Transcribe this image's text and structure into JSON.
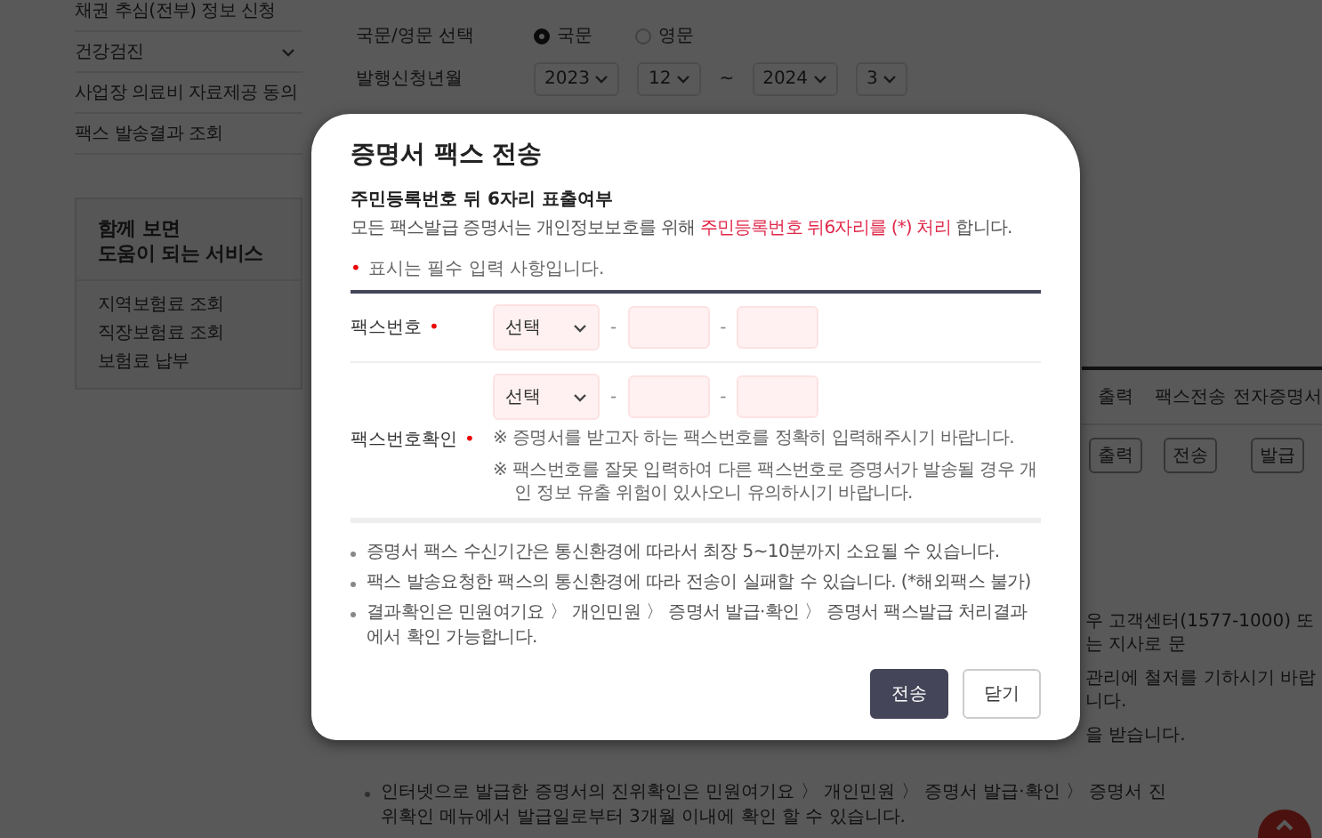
{
  "sidebar": {
    "items": [
      {
        "label": "채권 추심(전부) 정보 신청",
        "expandable": false
      },
      {
        "label": "건강검진",
        "expandable": true
      },
      {
        "label": "사업장 의료비 자료제공 동의",
        "expandable": false
      },
      {
        "label": "팩스 발송결과 조회",
        "expandable": false
      }
    ]
  },
  "related_services": {
    "title_lines": [
      "함께 보면",
      "도움이 되는 서비스"
    ],
    "items": [
      "지역보험료 조회",
      "직장보험료 조회",
      "보험료 납부"
    ]
  },
  "form": {
    "language": {
      "label": "국문/영문 선택",
      "options": [
        {
          "label": "국문",
          "selected": true
        },
        {
          "label": "영문",
          "selected": false
        }
      ]
    },
    "period": {
      "label": "발행신청년월",
      "from": {
        "year": "2023",
        "month": "12"
      },
      "separator": "~",
      "to": {
        "year": "2024",
        "month": "3"
      }
    }
  },
  "table": {
    "columns": [
      "출력",
      "팩스전송",
      "전자증명서"
    ],
    "rows": [
      [
        "출력",
        "전송",
        "발급"
      ]
    ]
  },
  "notes_behind": [
    "우 고객센터(1577-1000) 또는 지사로 문",
    "관리에 철저를 기하시기 바랍니다.",
    "을 받습니다."
  ],
  "footer_note": "인터넷으로 발급한 증명서의 진위확인은 민원여기요 〉 개인민원 〉 증명서 발급·확인 〉 증명서 진위확인 메뉴에서 발급일로부터 3개월 이내에 확인 할 수 있습니다.",
  "dialog": {
    "title": "증명서 팩스 전송",
    "section_title": "주민등록번호 뒤 6자리 표출여부",
    "notice": "모든 팩스발급 증명서는 개인정보보호를 위해 **주민등록번호 뒤6자리를 (*) 처리** 합니다.",
    "required_mark": "•",
    "required_note": "표시는 필수 입력 사항입니다.",
    "fields": [
      {
        "label": "팩스번호",
        "required": true,
        "select": "선택",
        "separator": "-"
      },
      {
        "label": "팩스번호확인",
        "required": true,
        "select": "선택",
        "separator": "-",
        "hints": [
          "※ 증명서를 받고자 하는 팩스번호를 정확히 입력해주시기 바랍니다.",
          "※ 팩스번호를 잘못 입력하여 다른 팩스번호로 증명서가 발송될 경우 개인 정보 유출 위험이 있사오니 유의하시기 바랍니다."
        ]
      }
    ],
    "info": [
      "증명서 팩스 수신기간은 통신환경에 따라서 최장 5~10분까지 소요될 수 있습니다.",
      "팩스 발송요청한 팩스의 통신환경에 따라 전송이 실패할 수 있습니다. (*해외팩스 불가)",
      "결과확인은 민원여기요 〉 개인민원 〉 증명서 발급·확인 〉 증명서 팩스발급 처리결과에서 확인 가능합니다."
    ],
    "buttons": [
      {
        "label": "전송",
        "kind": "primary"
      },
      {
        "label": "닫기",
        "kind": "secondary"
      }
    ]
  }
}
